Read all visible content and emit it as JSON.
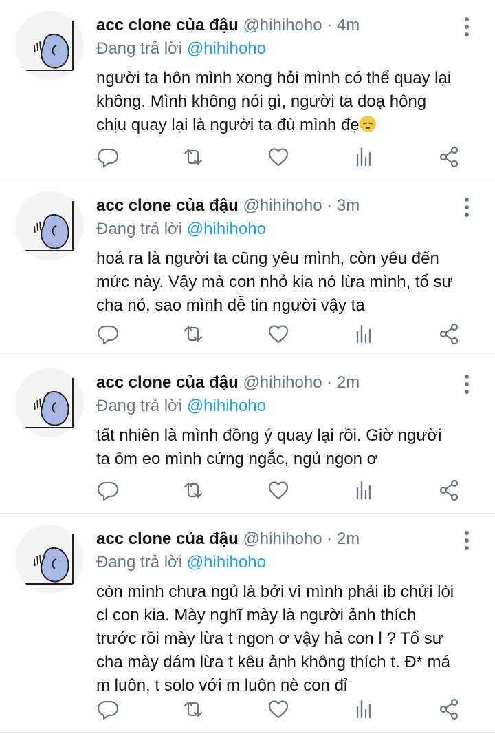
{
  "tweets": [
    {
      "display_name": "acc clone của đậu",
      "handle": "@hihihoho",
      "separator": "·",
      "time": "4m",
      "replying_prefix": "Đang trả lời",
      "replying_to": "@hihihoho",
      "lines": [
        "người ta hôn mình xong hỏi mình có thể quay lại",
        "không. Mình không nói gì, người ta doạ hông",
        "chịu quay lại là người ta đù mình đẹ"
      ],
      "emoji": "pensive-face"
    },
    {
      "display_name": "acc clone của đậu",
      "handle": "@hihihoho",
      "separator": "·",
      "time": "3m",
      "replying_prefix": "Đang trả lời",
      "replying_to": "@hihihoho",
      "lines": [
        "hoá ra là người ta cũng yêu mình, còn yêu đến",
        "mức này. Vậy mà con nhỏ kia nó lừa mình, tổ sư",
        "cha nó, sao mình dễ tin người vậy ta"
      ]
    },
    {
      "display_name": "acc clone của đậu",
      "handle": "@hihihoho",
      "separator": "·",
      "time": "2m",
      "replying_prefix": "Đang trả lời",
      "replying_to": "@hihihoho",
      "lines": [
        "tất nhiên là mình đồng ý quay lại rồi. Giờ người",
        "ta ôm eo mình cứng ngắc, ngủ ngon ơ"
      ]
    },
    {
      "display_name": "acc clone của đậu",
      "handle": "@hihihoho",
      "separator": "·",
      "time": "2m",
      "replying_prefix": "Đang trả lời",
      "replying_to": "@hihihoho",
      "lines": [
        "còn mình chưa ngủ là bởi vì mình phải ib chửi lòi",
        "cl con kia. Mày nghĩ mày là người ảnh thích",
        "trước rồi mày lừa t ngon ơ vậy hả con l ? Tổ sư",
        "cha mày dám lừa t kêu ảnh không thích t. Đ* má",
        "m luôn, t solo với m luôn nè con đỉ"
      ]
    }
  ],
  "icons": {
    "reply": "reply-icon",
    "retweet": "retweet-icon",
    "like": "heart-icon",
    "stats": "stats-icon",
    "share": "share-icon",
    "more": "more-vertical-icon"
  },
  "colors": {
    "mention": "#1da1f2",
    "secondary_text": "#657786",
    "icon": "#657786",
    "avatar": "#a9b9e6",
    "divider": "#e1e8ed"
  }
}
